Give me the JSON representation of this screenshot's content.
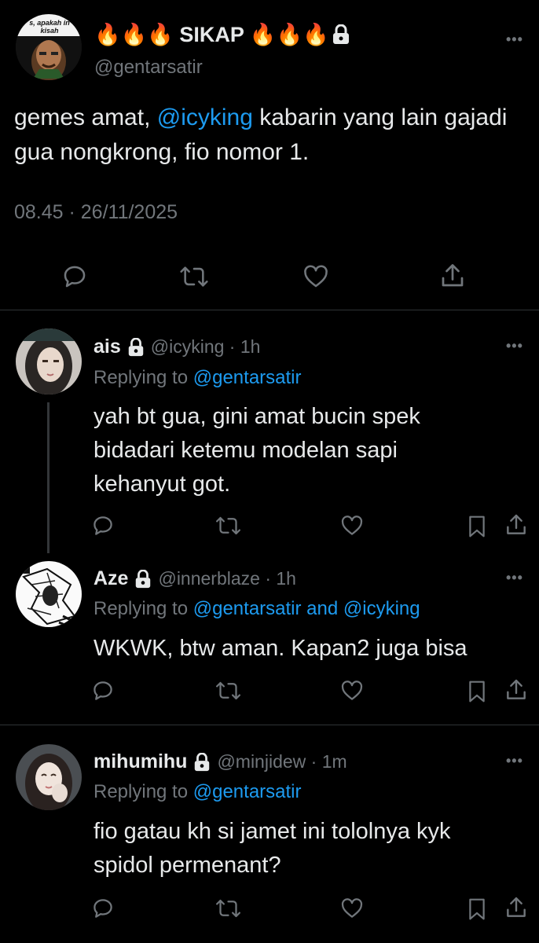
{
  "main_tweet": {
    "avatar_text": "s, apakah in kisah",
    "display_name": "🔥🔥🔥 SIKAP 🔥🔥🔥",
    "handle": "@gentarsatir",
    "text_before": "gemes amat, ",
    "mention": "@icyking",
    "text_after": " kabarin yang lain gajadi gua nongkrong, fio nomor 1.",
    "timestamp": "08.45 · 26/11/2025"
  },
  "replies": [
    {
      "display_name": "ais",
      "meta": "@icyking · 1h",
      "replying_prefix": "Replying to ",
      "replying_to": "@gentarsatir",
      "text": "yah bt gua, gini amat bucin spek bidadari ketemu modelan sapi kehanyut got."
    },
    {
      "display_name": "Aze",
      "meta": "@innerblaze · 1h",
      "replying_prefix": "Replying to ",
      "replying_to": "@gentarsatir and @icyking",
      "text": "WKWK, btw aman. Kapan2 juga bisa"
    },
    {
      "display_name": "mihumihu",
      "meta": "@minjidew · 1m",
      "replying_prefix": "Replying to ",
      "replying_to": "@gentarsatir",
      "text": "fio gatau kh si jamet ini tololnya kyk spidol permenant?"
    }
  ],
  "icons": [
    "reply-icon",
    "retweet-icon",
    "like-icon",
    "share-icon",
    "bookmark-icon",
    "lock-icon",
    "more-icon"
  ],
  "colors": {
    "background": "#000000",
    "text": "#e7e9ea",
    "muted": "#71767b",
    "link": "#1d9bf0",
    "divider": "#2f3336"
  }
}
